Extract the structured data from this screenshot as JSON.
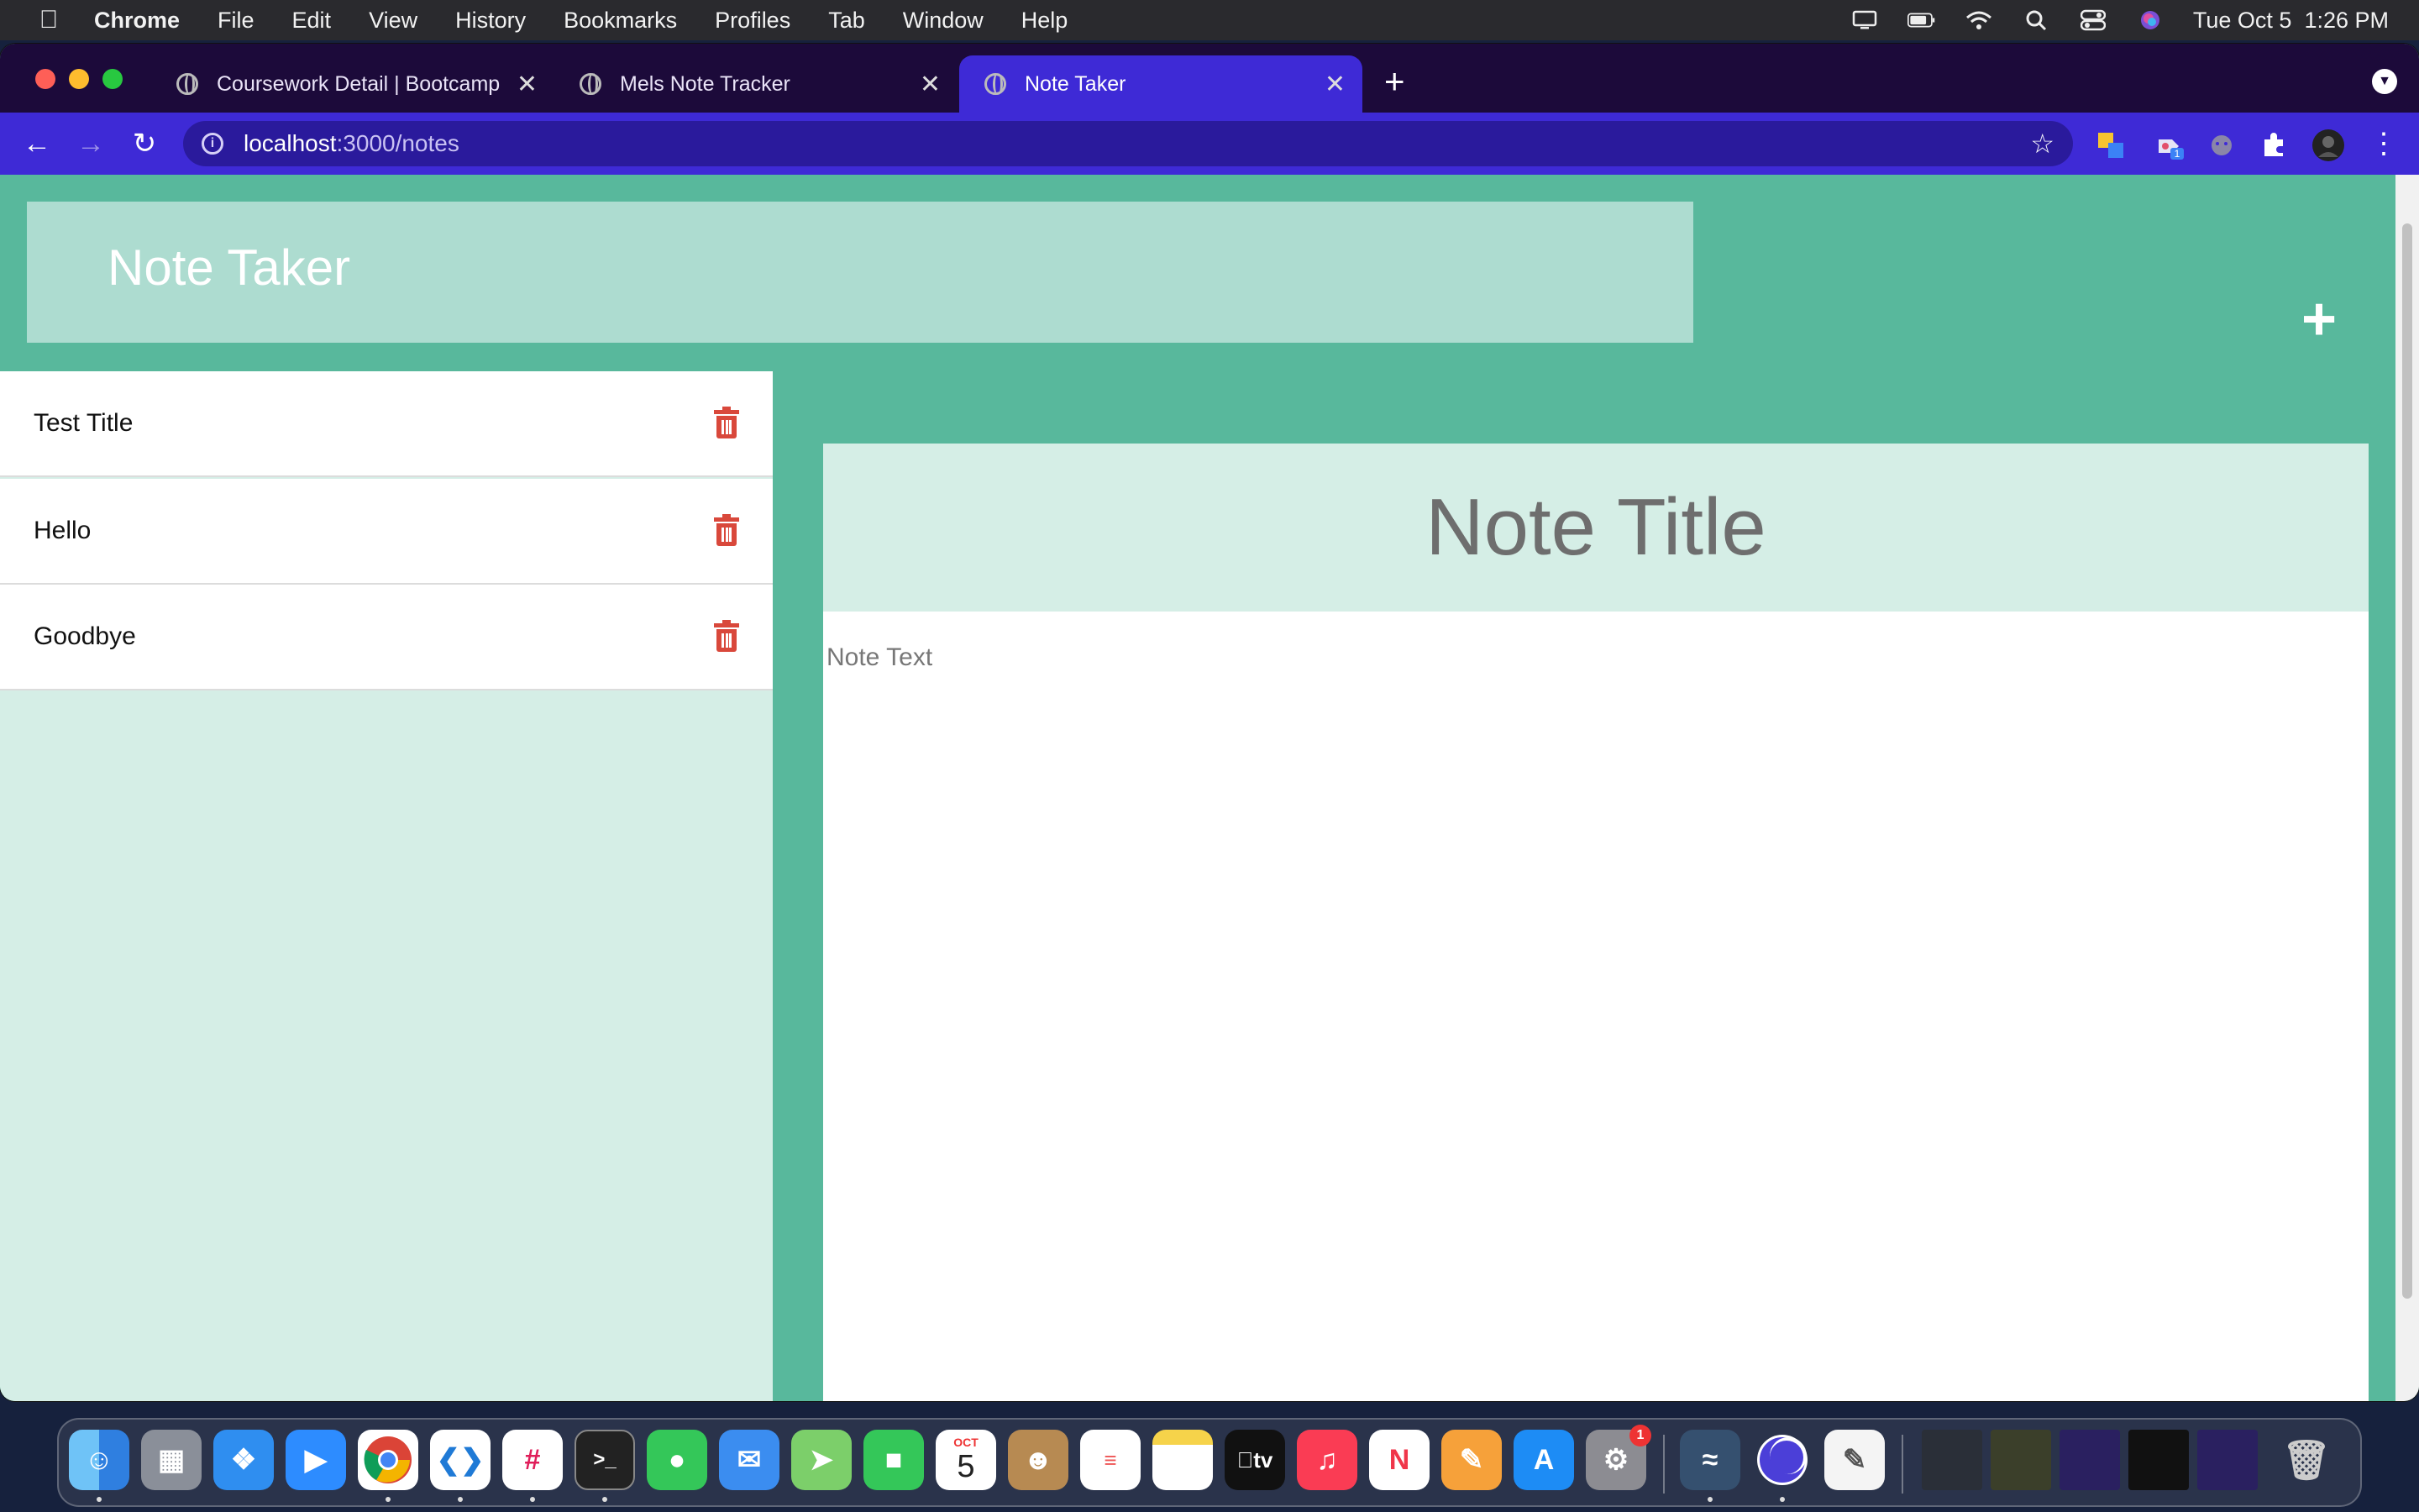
{
  "menubar": {
    "app_name": "Chrome",
    "items": [
      "File",
      "Edit",
      "View",
      "History",
      "Bookmarks",
      "Profiles",
      "Tab",
      "Window",
      "Help"
    ],
    "clock": "Tue Oct 5  1:26 PM"
  },
  "browser": {
    "tabs": [
      {
        "title": "Coursework Detail | Bootcamp"
      },
      {
        "title": "Mels Note Tracker"
      },
      {
        "title": "Note Taker"
      }
    ],
    "url_host": "localhost",
    "url_path": ":3000/notes",
    "extension_badge": "1"
  },
  "page": {
    "brand": "Note Taker",
    "new_note_icon": "+",
    "notes": [
      {
        "title": "Test Title"
      },
      {
        "title": "Hello"
      },
      {
        "title": "Goodbye"
      }
    ],
    "editor": {
      "title_placeholder": "Note Title",
      "text_placeholder": "Note Text"
    }
  },
  "dock": {
    "calendar_month": "OCT",
    "calendar_day": "5",
    "tv_label": "tv",
    "settings_badge": "1"
  },
  "colors": {
    "page_bg": "#58b89c",
    "nav_box": "#addcd0",
    "sidebar_bg": "#d5eee6",
    "trash_red": "#d9483b",
    "tab_active": "#3e2ad6",
    "tabstrip": "#1c0a3a"
  }
}
